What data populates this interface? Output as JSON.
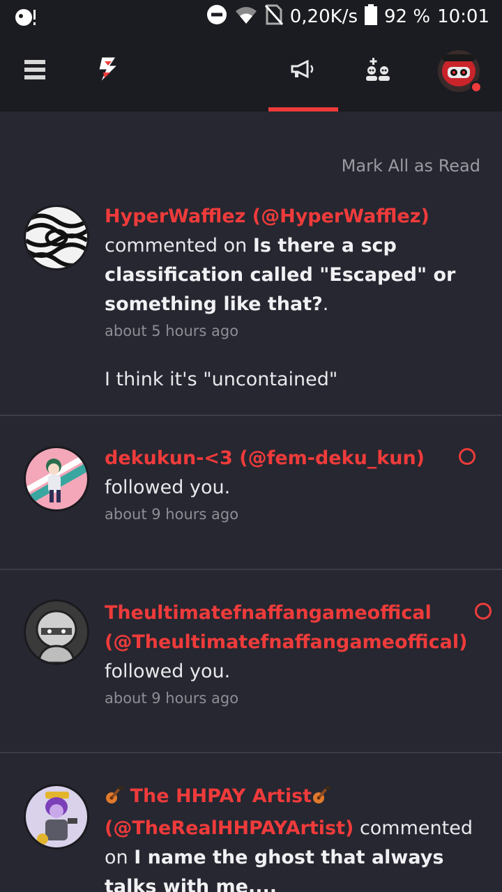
{
  "status_bar": {
    "speed": "0,20K/s",
    "battery": "92 %",
    "time": "10:01"
  },
  "nav": {
    "menu_icon": "hamburger-icon",
    "logo_icon": "lightning-logo-icon",
    "tabs": [
      {
        "icon": "megaphone-icon",
        "active": true
      },
      {
        "icon": "friends-icon",
        "active": false
      }
    ],
    "accent_color": "#ef3b3b"
  },
  "mark_all_label": "Mark All as Read",
  "notifications": [
    {
      "user": "HyperWafflez (@HyperWafflez)",
      "action": "commented on",
      "post": "Is there a scp classification called \"Escaped\" or something like that?",
      "post_suffix": ".",
      "time": "about 5 hours ago",
      "body": "I think it's \"uncontained\"",
      "unread": false
    },
    {
      "user": "dekukun-<3 (@fem-deku_kun)",
      "action": "followed you.",
      "time": "about 9 hours ago",
      "unread": true
    },
    {
      "user": "Theultimatefnaffangameoffical (@Theultimatefnaffangameoffical)",
      "action": "followed you.",
      "time": "about 9 hours ago",
      "unread": true
    },
    {
      "user_prefix_icon": "guitar-icon",
      "user": "The HHPAY Artist",
      "user_suffix_icon": "guitar-icon",
      "handle": "(@TheRealHHPAYArtist)",
      "action": "commented on",
      "post": "I name the ghost that always talks with me....",
      "unread": false
    }
  ]
}
